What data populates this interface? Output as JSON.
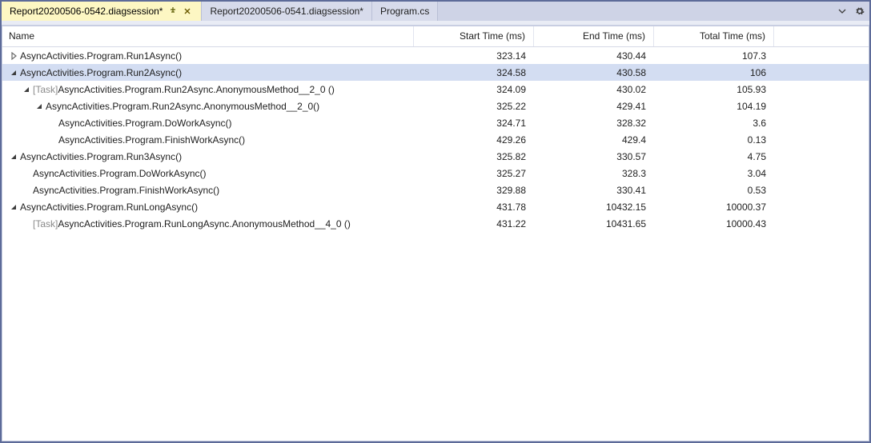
{
  "tabs": [
    {
      "label": "Report20200506-0542.diagsession*",
      "active": true,
      "pinned": true,
      "closeable": true
    },
    {
      "label": "Report20200506-0541.diagsession*",
      "active": false,
      "pinned": false,
      "closeable": false
    },
    {
      "label": "Program.cs",
      "active": false,
      "pinned": false,
      "closeable": false
    }
  ],
  "columns": {
    "name": "Name",
    "start": "Start Time (ms)",
    "end": "End Time (ms)",
    "total": "Total Time (ms)"
  },
  "rows": [
    {
      "depth": 0,
      "expander": "collapsed",
      "task": false,
      "name": "AsyncActivities.Program.Run1Async()",
      "start": "323.14",
      "end": "430.44",
      "total": "107.3",
      "selected": false
    },
    {
      "depth": 0,
      "expander": "expanded",
      "task": false,
      "name": "AsyncActivities.Program.Run2Async()",
      "start": "324.58",
      "end": "430.58",
      "total": "106",
      "selected": true
    },
    {
      "depth": 1,
      "expander": "expanded",
      "task": true,
      "name": "AsyncActivities.Program.Run2Async.AnonymousMethod__2_0 ()",
      "start": "324.09",
      "end": "430.02",
      "total": "105.93",
      "selected": false
    },
    {
      "depth": 2,
      "expander": "expanded",
      "task": false,
      "name": "AsyncActivities.Program.Run2Async.AnonymousMethod__2_0()",
      "start": "325.22",
      "end": "429.41",
      "total": "104.19",
      "selected": false
    },
    {
      "depth": 3,
      "expander": "none",
      "task": false,
      "name": "AsyncActivities.Program.DoWorkAsync()",
      "start": "324.71",
      "end": "328.32",
      "total": "3.6",
      "selected": false
    },
    {
      "depth": 3,
      "expander": "none",
      "task": false,
      "name": "AsyncActivities.Program.FinishWorkAsync()",
      "start": "429.26",
      "end": "429.4",
      "total": "0.13",
      "selected": false
    },
    {
      "depth": 0,
      "expander": "expanded",
      "task": false,
      "name": "AsyncActivities.Program.Run3Async()",
      "start": "325.82",
      "end": "330.57",
      "total": "4.75",
      "selected": false
    },
    {
      "depth": 1,
      "expander": "none",
      "task": false,
      "name": "AsyncActivities.Program.DoWorkAsync()",
      "start": "325.27",
      "end": "328.3",
      "total": "3.04",
      "selected": false
    },
    {
      "depth": 1,
      "expander": "none",
      "task": false,
      "name": "AsyncActivities.Program.FinishWorkAsync()",
      "start": "329.88",
      "end": "330.41",
      "total": "0.53",
      "selected": false
    },
    {
      "depth": 0,
      "expander": "expanded",
      "task": false,
      "name": "AsyncActivities.Program.RunLongAsync()",
      "start": "431.78",
      "end": "10432.15",
      "total": "10000.37",
      "selected": false
    },
    {
      "depth": 1,
      "expander": "none",
      "task": true,
      "name": "AsyncActivities.Program.RunLongAsync.AnonymousMethod__4_0 ()",
      "start": "431.22",
      "end": "10431.65",
      "total": "10000.43",
      "selected": false
    }
  ],
  "task_label": "[Task]"
}
